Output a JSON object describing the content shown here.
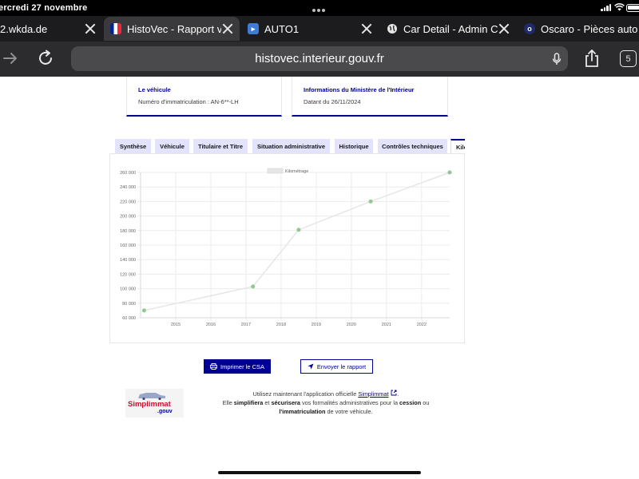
{
  "status_bar": {
    "date": "ercredi 27 novembre"
  },
  "tabs": [
    {
      "title": "2.wkda.de",
      "favicon": "page-icon",
      "active": false
    },
    {
      "title": "HistoVec - Rapport véhicule",
      "favicon": "french-flag-icon",
      "active": true
    },
    {
      "title": "AUTO1",
      "favicon": "auto1-icon",
      "active": false
    },
    {
      "title": "Car Detail - Admin Center",
      "favicon": "globe-icon",
      "active": false
    },
    {
      "title": "Oscaro - Pièces auto",
      "favicon": "oscaro-icon",
      "active": false
    }
  ],
  "toolbar": {
    "url": "histovec.interieur.gouv.fr",
    "tab_count": "5"
  },
  "cards": [
    {
      "title": "Le véhicule",
      "value": "Numéro d'immatriculation : AN-6**-LH"
    },
    {
      "title": "Informations du Ministère de l'Intérieur",
      "value": "Datant du 26/11/2024"
    }
  ],
  "page_tabs": [
    {
      "label": "Synthèse"
    },
    {
      "label": "Véhicule"
    },
    {
      "label": "Titulaire et Titre"
    },
    {
      "label": "Situation administrative"
    },
    {
      "label": "Historique"
    },
    {
      "label": "Contrôles techniques"
    },
    {
      "label": "Kilométrage",
      "active": true
    }
  ],
  "chart_data": {
    "type": "line",
    "legend": [
      "Kilométrage"
    ],
    "legend_position": "top-center",
    "grid": true,
    "x_ticks": [
      "2015",
      "2016",
      "2017",
      "2018",
      "2019",
      "2020",
      "2021",
      "2022"
    ],
    "y_ticks": [
      "60 000",
      "80 000",
      "100 000",
      "120 000",
      "140 000",
      "160 000",
      "180 000",
      "200 000",
      "220 000",
      "240 000",
      "260 000"
    ],
    "xlim": [
      2014.0,
      2022.8
    ],
    "ylim": [
      60000,
      260000
    ],
    "series": [
      {
        "name": "Kilométrage",
        "color": "#e6e6e6",
        "point_color": "#8fc98f",
        "points": [
          {
            "x": 2014.1,
            "y": 70000
          },
          {
            "x": 2017.2,
            "y": 103000
          },
          {
            "x": 2018.5,
            "y": 181000
          },
          {
            "x": 2020.55,
            "y": 220000
          },
          {
            "x": 2022.8,
            "y": 260000
          }
        ]
      }
    ]
  },
  "actions": {
    "print_label": "Imprimer le CSA",
    "send_label": "Envoyer le rapport"
  },
  "promo": {
    "logo_main": "Simplimmat",
    "logo_sub": ".gouv",
    "line1_prefix": "Utilisez maintenant l'application officielle ",
    "app_link": "Simplimmat",
    "line1_suffix": ".",
    "line2_a": "Elle ",
    "simplifiera": "simplifiera",
    "line2_b": " et ",
    "securisera": "sécurisera",
    "line2_c": " vos formalités administratives pour la ",
    "cession": "cession",
    "line2_d": " ou",
    "immatriculation": "l'immatriculation",
    "line3": " de votre véhicule."
  },
  "colors": {
    "dsfr_blue": "#000091",
    "tab_bg": "#e3e3fd"
  }
}
